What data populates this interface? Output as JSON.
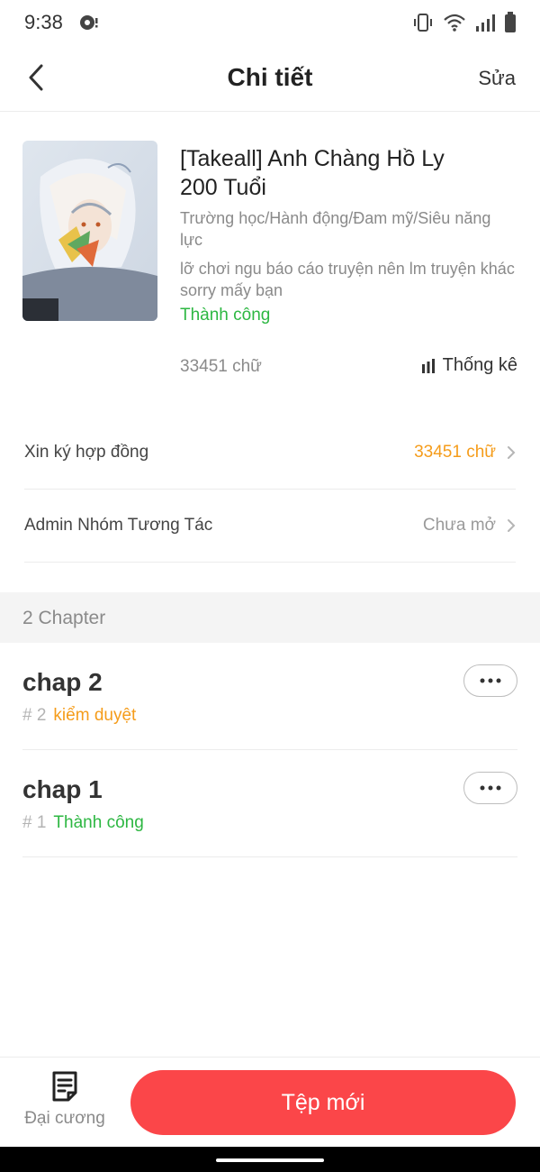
{
  "status_bar": {
    "time": "9:38",
    "icons": [
      "vibrate-icon",
      "wifi-icon",
      "signal-icon",
      "battery-icon"
    ]
  },
  "header": {
    "title": "Chi tiết",
    "edit_label": "Sửa"
  },
  "book": {
    "title": "[Takeall] Anh Chàng Hồ Ly 200 Tuổi",
    "genres": "Trường học/Hành động/Đam mỹ/Siêu năng lực",
    "description": "lỡ chơi ngu báo cáo truyện nên lm truyện khác  sorry mấy bạn",
    "status": "Thành công",
    "word_count": "33451 chữ",
    "stats_label": "Thống kê"
  },
  "rows": [
    {
      "label": "Xin ký hợp đồng",
      "value": "33451 chữ"
    },
    {
      "label": "Admin Nhóm Tương Tác",
      "value": "Chưa mở"
    }
  ],
  "chapters_section": {
    "label": "2 Chapter",
    "items": [
      {
        "title": "chap 2",
        "number": "# 2",
        "status": "kiểm duyệt"
      },
      {
        "title": "chap 1",
        "number": "# 1",
        "status": "Thành công"
      }
    ]
  },
  "bottom_bar": {
    "outline_label": "Đại cương",
    "new_file_label": "Tệp mới"
  },
  "colors": {
    "accent_red": "#fb4649",
    "success_green": "#2db742",
    "warning_orange": "#f59c1a"
  }
}
